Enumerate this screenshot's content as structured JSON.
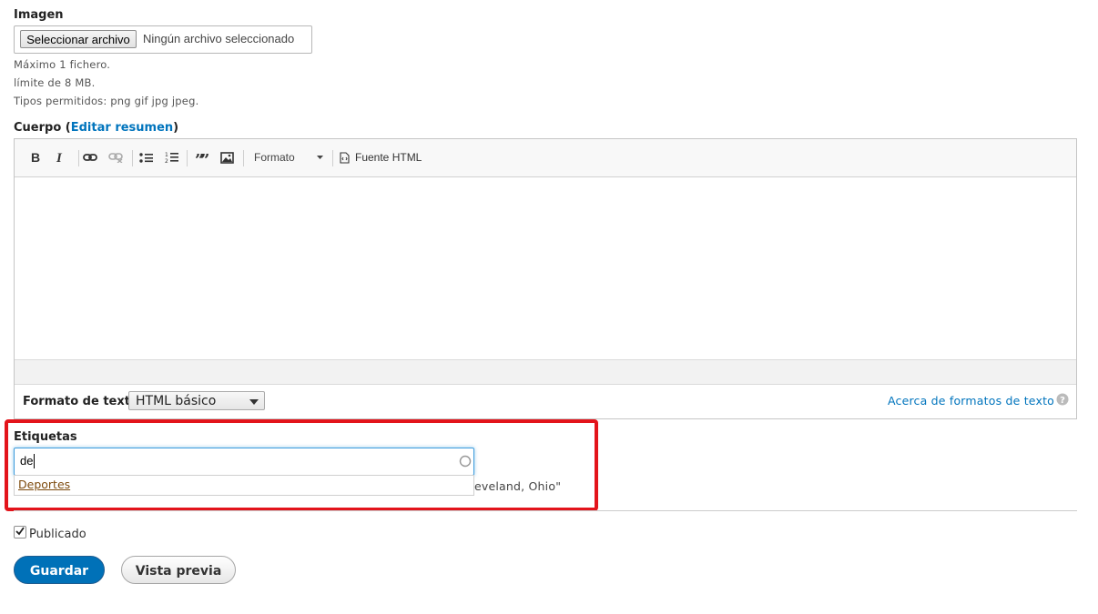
{
  "image_field": {
    "label": "Imagen",
    "choose_button": "Seleccionar archivo",
    "status": "Ningún archivo seleccionado",
    "help": [
      "Máximo 1 fichero.",
      "límite de 8 MB.",
      "Tipos permitidos: png gif jpg jpeg."
    ]
  },
  "body_field": {
    "label": "Cuerpo",
    "open_paren": "(",
    "edit_summary_link": "Editar resumen",
    "close_paren": ")",
    "toolbar": {
      "format_dropdown": "Formato",
      "source_button": "Fuente HTML",
      "icons": [
        "bold-icon",
        "italic-icon",
        "link-icon",
        "unlink-icon",
        "bulleted-list-icon",
        "numbered-list-icon",
        "blockquote-icon",
        "image-icon"
      ]
    },
    "text_format_label": "Formato de texto",
    "text_format_value": "HTML básico",
    "about_formats_link": "Acerca de formatos de texto"
  },
  "tags_field": {
    "label": "Etiquetas",
    "input_value": "de",
    "suggestion": "Deportes",
    "help_partial": "eveland, Ohio\""
  },
  "published": {
    "label": "Publicado",
    "checked": true
  },
  "actions": {
    "save": "Guardar",
    "preview": "Vista previa"
  },
  "colors": {
    "primary": "#0071b8",
    "link": "#0074bd",
    "highlight": "#e3141b",
    "suggestion_link": "#7d4a0d"
  }
}
